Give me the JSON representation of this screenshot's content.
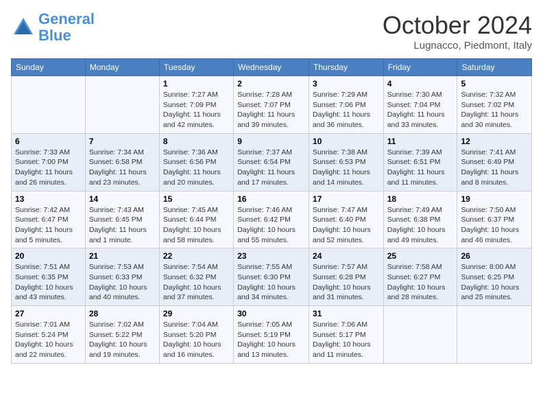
{
  "header": {
    "logo_line1": "General",
    "logo_line2": "Blue",
    "month": "October 2024",
    "location": "Lugnacco, Piedmont, Italy"
  },
  "weekdays": [
    "Sunday",
    "Monday",
    "Tuesday",
    "Wednesday",
    "Thursday",
    "Friday",
    "Saturday"
  ],
  "weeks": [
    [
      {
        "day": "",
        "sunrise": "",
        "sunset": "",
        "daylight": ""
      },
      {
        "day": "",
        "sunrise": "",
        "sunset": "",
        "daylight": ""
      },
      {
        "day": "1",
        "sunrise": "Sunrise: 7:27 AM",
        "sunset": "Sunset: 7:09 PM",
        "daylight": "Daylight: 11 hours and 42 minutes."
      },
      {
        "day": "2",
        "sunrise": "Sunrise: 7:28 AM",
        "sunset": "Sunset: 7:07 PM",
        "daylight": "Daylight: 11 hours and 39 minutes."
      },
      {
        "day": "3",
        "sunrise": "Sunrise: 7:29 AM",
        "sunset": "Sunset: 7:06 PM",
        "daylight": "Daylight: 11 hours and 36 minutes."
      },
      {
        "day": "4",
        "sunrise": "Sunrise: 7:30 AM",
        "sunset": "Sunset: 7:04 PM",
        "daylight": "Daylight: 11 hours and 33 minutes."
      },
      {
        "day": "5",
        "sunrise": "Sunrise: 7:32 AM",
        "sunset": "Sunset: 7:02 PM",
        "daylight": "Daylight: 11 hours and 30 minutes."
      }
    ],
    [
      {
        "day": "6",
        "sunrise": "Sunrise: 7:33 AM",
        "sunset": "Sunset: 7:00 PM",
        "daylight": "Daylight: 11 hours and 26 minutes."
      },
      {
        "day": "7",
        "sunrise": "Sunrise: 7:34 AM",
        "sunset": "Sunset: 6:58 PM",
        "daylight": "Daylight: 11 hours and 23 minutes."
      },
      {
        "day": "8",
        "sunrise": "Sunrise: 7:36 AM",
        "sunset": "Sunset: 6:56 PM",
        "daylight": "Daylight: 11 hours and 20 minutes."
      },
      {
        "day": "9",
        "sunrise": "Sunrise: 7:37 AM",
        "sunset": "Sunset: 6:54 PM",
        "daylight": "Daylight: 11 hours and 17 minutes."
      },
      {
        "day": "10",
        "sunrise": "Sunrise: 7:38 AM",
        "sunset": "Sunset: 6:53 PM",
        "daylight": "Daylight: 11 hours and 14 minutes."
      },
      {
        "day": "11",
        "sunrise": "Sunrise: 7:39 AM",
        "sunset": "Sunset: 6:51 PM",
        "daylight": "Daylight: 11 hours and 11 minutes."
      },
      {
        "day": "12",
        "sunrise": "Sunrise: 7:41 AM",
        "sunset": "Sunset: 6:49 PM",
        "daylight": "Daylight: 11 hours and 8 minutes."
      }
    ],
    [
      {
        "day": "13",
        "sunrise": "Sunrise: 7:42 AM",
        "sunset": "Sunset: 6:47 PM",
        "daylight": "Daylight: 11 hours and 5 minutes."
      },
      {
        "day": "14",
        "sunrise": "Sunrise: 7:43 AM",
        "sunset": "Sunset: 6:45 PM",
        "daylight": "Daylight: 11 hours and 1 minute."
      },
      {
        "day": "15",
        "sunrise": "Sunrise: 7:45 AM",
        "sunset": "Sunset: 6:44 PM",
        "daylight": "Daylight: 10 hours and 58 minutes."
      },
      {
        "day": "16",
        "sunrise": "Sunrise: 7:46 AM",
        "sunset": "Sunset: 6:42 PM",
        "daylight": "Daylight: 10 hours and 55 minutes."
      },
      {
        "day": "17",
        "sunrise": "Sunrise: 7:47 AM",
        "sunset": "Sunset: 6:40 PM",
        "daylight": "Daylight: 10 hours and 52 minutes."
      },
      {
        "day": "18",
        "sunrise": "Sunrise: 7:49 AM",
        "sunset": "Sunset: 6:38 PM",
        "daylight": "Daylight: 10 hours and 49 minutes."
      },
      {
        "day": "19",
        "sunrise": "Sunrise: 7:50 AM",
        "sunset": "Sunset: 6:37 PM",
        "daylight": "Daylight: 10 hours and 46 minutes."
      }
    ],
    [
      {
        "day": "20",
        "sunrise": "Sunrise: 7:51 AM",
        "sunset": "Sunset: 6:35 PM",
        "daylight": "Daylight: 10 hours and 43 minutes."
      },
      {
        "day": "21",
        "sunrise": "Sunrise: 7:53 AM",
        "sunset": "Sunset: 6:33 PM",
        "daylight": "Daylight: 10 hours and 40 minutes."
      },
      {
        "day": "22",
        "sunrise": "Sunrise: 7:54 AM",
        "sunset": "Sunset: 6:32 PM",
        "daylight": "Daylight: 10 hours and 37 minutes."
      },
      {
        "day": "23",
        "sunrise": "Sunrise: 7:55 AM",
        "sunset": "Sunset: 6:30 PM",
        "daylight": "Daylight: 10 hours and 34 minutes."
      },
      {
        "day": "24",
        "sunrise": "Sunrise: 7:57 AM",
        "sunset": "Sunset: 6:28 PM",
        "daylight": "Daylight: 10 hours and 31 minutes."
      },
      {
        "day": "25",
        "sunrise": "Sunrise: 7:58 AM",
        "sunset": "Sunset: 6:27 PM",
        "daylight": "Daylight: 10 hours and 28 minutes."
      },
      {
        "day": "26",
        "sunrise": "Sunrise: 8:00 AM",
        "sunset": "Sunset: 6:25 PM",
        "daylight": "Daylight: 10 hours and 25 minutes."
      }
    ],
    [
      {
        "day": "27",
        "sunrise": "Sunrise: 7:01 AM",
        "sunset": "Sunset: 5:24 PM",
        "daylight": "Daylight: 10 hours and 22 minutes."
      },
      {
        "day": "28",
        "sunrise": "Sunrise: 7:02 AM",
        "sunset": "Sunset: 5:22 PM",
        "daylight": "Daylight: 10 hours and 19 minutes."
      },
      {
        "day": "29",
        "sunrise": "Sunrise: 7:04 AM",
        "sunset": "Sunset: 5:20 PM",
        "daylight": "Daylight: 10 hours and 16 minutes."
      },
      {
        "day": "30",
        "sunrise": "Sunrise: 7:05 AM",
        "sunset": "Sunset: 5:19 PM",
        "daylight": "Daylight: 10 hours and 13 minutes."
      },
      {
        "day": "31",
        "sunrise": "Sunrise: 7:06 AM",
        "sunset": "Sunset: 5:17 PM",
        "daylight": "Daylight: 10 hours and 11 minutes."
      },
      {
        "day": "",
        "sunrise": "",
        "sunset": "",
        "daylight": ""
      },
      {
        "day": "",
        "sunrise": "",
        "sunset": "",
        "daylight": ""
      }
    ]
  ]
}
